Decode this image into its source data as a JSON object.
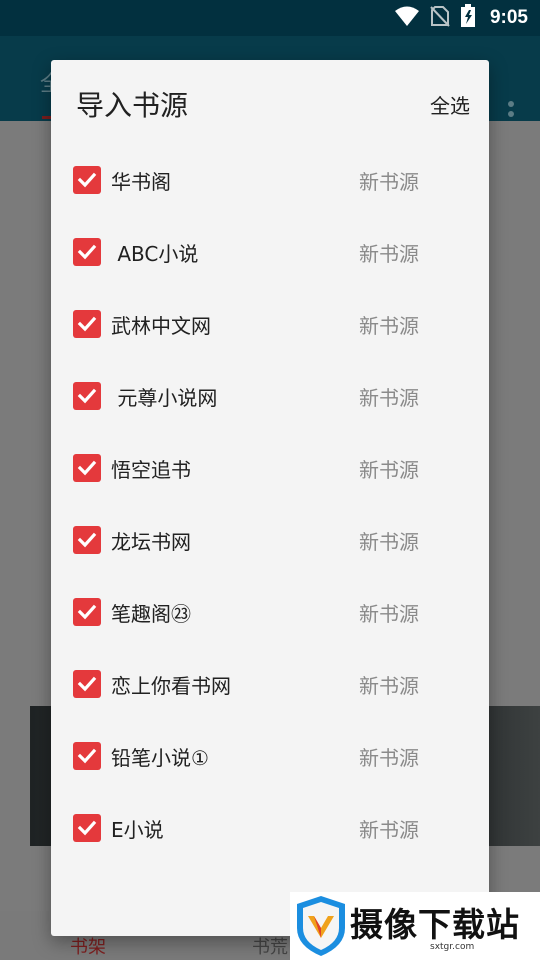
{
  "status_bar": {
    "time": "9:05",
    "icons": [
      "wifi-icon",
      "no-sim-icon",
      "battery-charging-icon"
    ]
  },
  "background_app": {
    "toolbar_tab": "全",
    "bottom_tabs": [
      "书架",
      "书荒"
    ]
  },
  "dialog": {
    "title": "导入书源",
    "select_all_label": "全选",
    "sources": [
      {
        "name": "华书阁",
        "tag": "新书源",
        "checked": true
      },
      {
        "name": " ABC小说",
        "tag": "新书源",
        "checked": true
      },
      {
        "name": "武林中文网",
        "tag": "新书源",
        "checked": true
      },
      {
        "name": " 元尊小说网",
        "tag": "新书源",
        "checked": true
      },
      {
        "name": "悟空追书",
        "tag": "新书源",
        "checked": true
      },
      {
        "name": "龙坛书网",
        "tag": "新书源",
        "checked": true
      },
      {
        "name": "笔趣阁㉓",
        "tag": "新书源",
        "checked": true
      },
      {
        "name": "恋上你看书网",
        "tag": "新书源",
        "checked": true
      },
      {
        "name": "铅笔小说①",
        "tag": "新书源",
        "checked": true
      },
      {
        "name": "E小说",
        "tag": "新书源",
        "checked": true
      }
    ]
  },
  "watermark": {
    "text": "摄像下载站",
    "url": "sxtgr.com"
  },
  "colors": {
    "accent": "#e4393c",
    "status_bar": "#02303f",
    "toolbar": "#073b4a",
    "dialog_bg": "#f4f4f4"
  }
}
